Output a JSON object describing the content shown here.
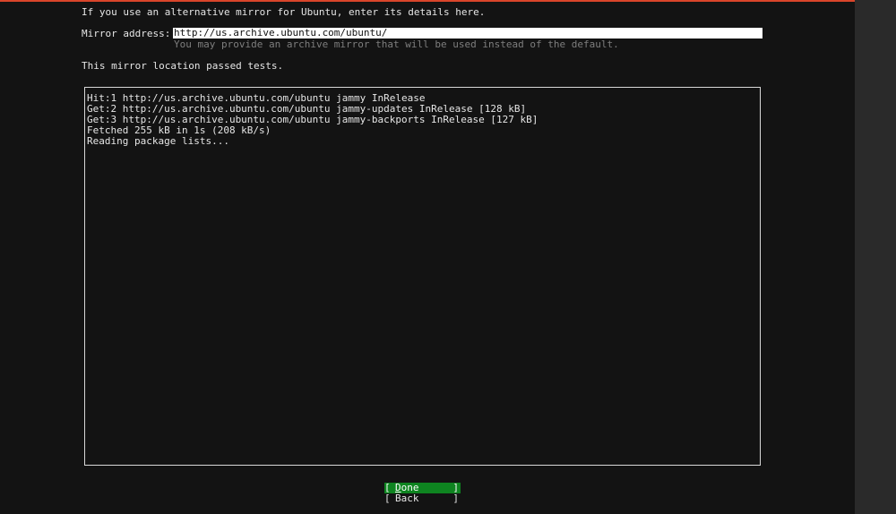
{
  "intro_text": "If you use an alternative mirror for Ubuntu, enter its details here.",
  "mirror": {
    "label": "Mirror address:",
    "value": "http://us.archive.ubuntu.com/ubuntu/",
    "hint": "You may provide an archive mirror that will be used instead of the default."
  },
  "status_text": "This mirror location passed tests.",
  "log": [
    "Hit:1 http://us.archive.ubuntu.com/ubuntu jammy InRelease",
    "Get:2 http://us.archive.ubuntu.com/ubuntu jammy-updates InRelease [128 kB]",
    "Get:3 http://us.archive.ubuntu.com/ubuntu jammy-backports InRelease [127 kB]",
    "Fetched 255 kB in 1s (208 kB/s)",
    "Reading package lists..."
  ],
  "buttons": {
    "bracket_left": "[",
    "bracket_right": "]",
    "done_first": "D",
    "done_rest": "one",
    "back": "Back"
  },
  "colors": {
    "accent_bar": "#d9452a",
    "button_focus": "#0e8420"
  }
}
